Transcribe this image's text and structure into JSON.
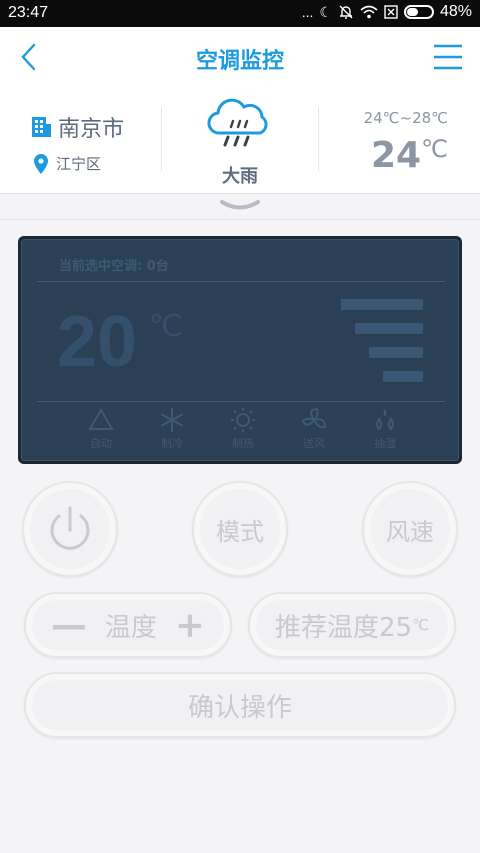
{
  "status_bar": {
    "time": "23:47",
    "dots": "...",
    "battery_percent": "48%",
    "battery_level": 0.48
  },
  "header": {
    "title": "空调监控",
    "back_icon": "chevron-left-icon",
    "menu_icon": "hamburger-menu-icon",
    "accent_color": "#1e9be0"
  },
  "weather": {
    "city": "南京市",
    "district": "江宁区",
    "condition": "大雨",
    "temp_range": "24℃~28℃",
    "current_temp": "24",
    "temp_unit": "℃",
    "icon": "heavy-rain-cloud-icon"
  },
  "lcd": {
    "selected_label": "当前选中空调: 0台",
    "temperature": "20",
    "temp_unit": "℃",
    "fan_level": 4,
    "modes": [
      {
        "label": "自动",
        "icon": "recycle-icon"
      },
      {
        "label": "制冷",
        "icon": "snowflake-icon"
      },
      {
        "label": "制热",
        "icon": "sun-icon"
      },
      {
        "label": "送风",
        "icon": "fan-icon"
      },
      {
        "label": "抽湿",
        "icon": "droplets-icon"
      }
    ]
  },
  "controls": {
    "power_icon": "power-icon",
    "mode_label": "模式",
    "fan_speed_label": "风速",
    "temp_minus": "—",
    "temp_label": "温度",
    "temp_plus": "+",
    "recommend_label": "推荐温度25",
    "recommend_unit": "℃",
    "confirm_label": "确认操作"
  }
}
